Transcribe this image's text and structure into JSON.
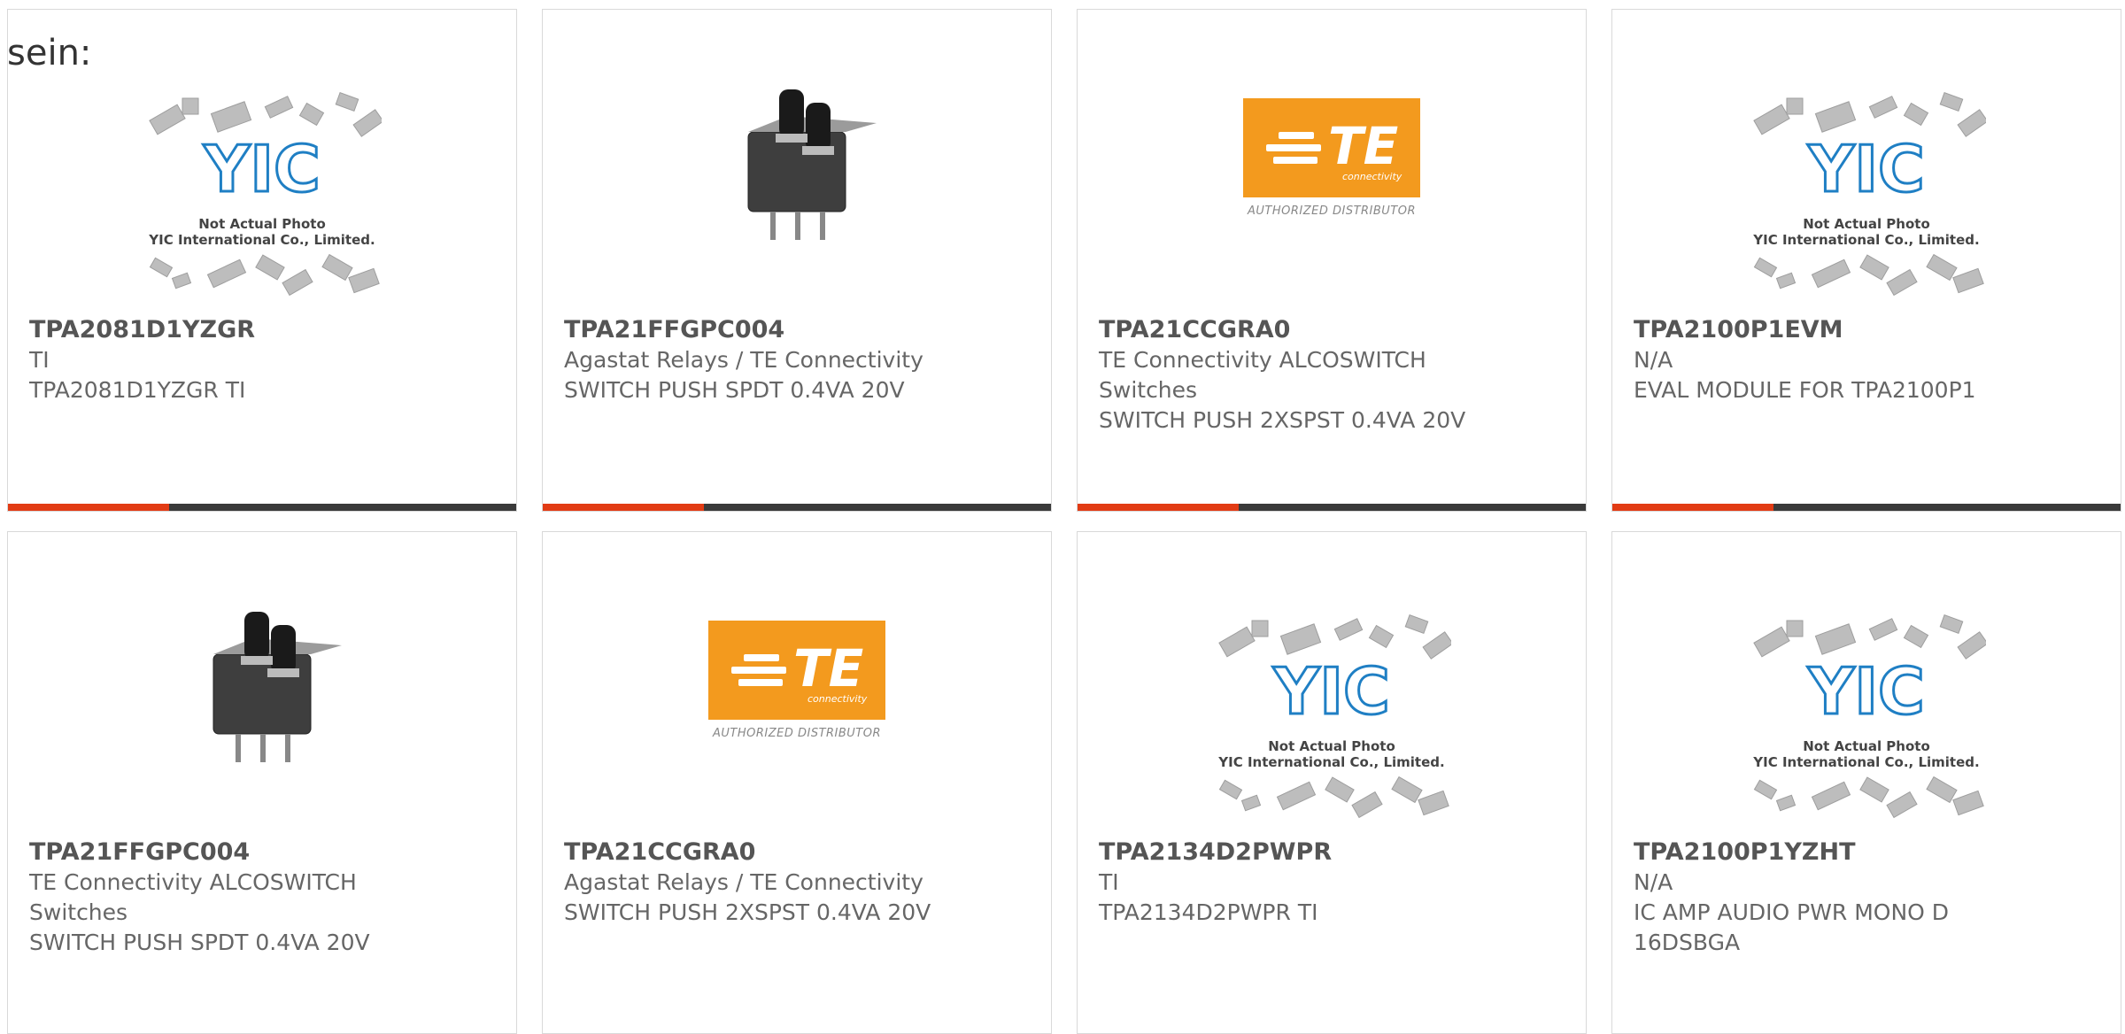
{
  "heading": "sein:",
  "cards": [
    {
      "pn": "TPA2081D1YZGR",
      "mfr": "TI",
      "desc": "TPA2081D1YZGR TI",
      "image": "yic-placeholder"
    },
    {
      "pn": "TPA21FFGPC004",
      "mfr": "Agastat Relays / TE Connectivity",
      "desc": "SWITCH PUSH SPDT 0.4VA 20V",
      "image": "push-switch"
    },
    {
      "pn": "TPA21CCGRA0",
      "mfr": "TE Connectivity ALCOSWITCH Switches",
      "desc": "SWITCH PUSH 2XSPST 0.4VA 20V",
      "image": "te-logo"
    },
    {
      "pn": "TPA2100P1EVM",
      "mfr": "N/A",
      "desc": "EVAL MODULE FOR TPA2100P1",
      "image": "yic-placeholder"
    },
    {
      "pn": "TPA21FFGPC004",
      "mfr": "TE Connectivity ALCOSWITCH Switches",
      "desc": "SWITCH PUSH SPDT 0.4VA 20V",
      "image": "push-switch"
    },
    {
      "pn": "TPA21CCGRA0",
      "mfr": "Agastat Relays / TE Connectivity",
      "desc": "SWITCH PUSH 2XSPST 0.4VA 20V",
      "image": "te-logo"
    },
    {
      "pn": "TPA2134D2PWPR",
      "mfr": "TI",
      "desc": "TPA2134D2PWPR TI",
      "image": "yic-placeholder"
    },
    {
      "pn": "TPA2100P1YZHT",
      "mfr": "N/A",
      "desc": "IC AMP AUDIO PWR MONO D 16DSBGA",
      "image": "yic-placeholder"
    }
  ],
  "yic": {
    "logo": "YIC",
    "line1": "Not Actual Photo",
    "line2": "YIC International Co., Limited."
  },
  "te": {
    "word": "TE",
    "sub": "connectivity",
    "caption": "AUTHORIZED DISTRIBUTOR"
  },
  "colors": {
    "accent": "#e23b14",
    "bar": "#3a3a3a",
    "te_orange": "#f39a1e",
    "yic_blue": "#1f7fc4"
  }
}
